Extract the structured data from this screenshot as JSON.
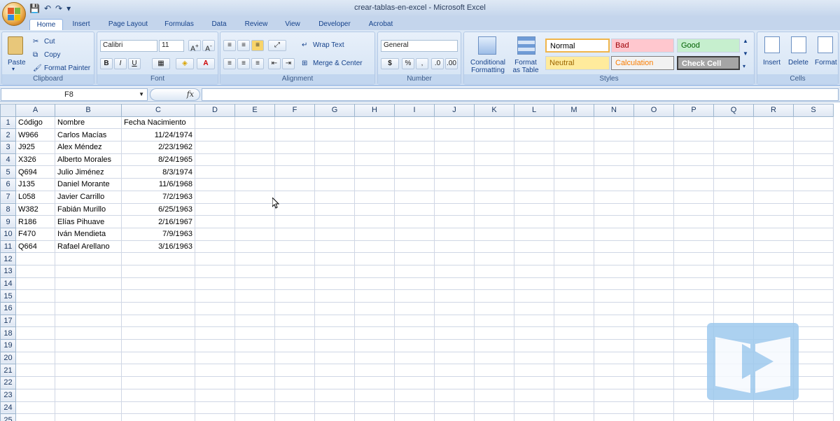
{
  "window": {
    "title": "crear-tablas-en-excel - Microsoft Excel"
  },
  "tabs": [
    "Home",
    "Insert",
    "Page Layout",
    "Formulas",
    "Data",
    "Review",
    "View",
    "Developer",
    "Acrobat"
  ],
  "active_tab": "Home",
  "clipboard": {
    "paste": "Paste",
    "cut": "Cut",
    "copy": "Copy",
    "format_painter": "Format Painter",
    "label": "Clipboard"
  },
  "font": {
    "name": "Calibri",
    "size": "11",
    "label": "Font",
    "bold": "B",
    "italic": "I",
    "underline": "U"
  },
  "alignment": {
    "wrap": "Wrap Text",
    "merge": "Merge & Center",
    "label": "Alignment"
  },
  "number": {
    "format": "General",
    "currency": "$",
    "percent": "%",
    "comma": ",",
    "label": "Number"
  },
  "styles": {
    "label": "Styles",
    "conditional": "Conditional Formatting",
    "format_table": "Format as Table",
    "normal": "Normal",
    "bad": "Bad",
    "good": "Good",
    "neutral": "Neutral",
    "calculation": "Calculation",
    "check": "Check Cell"
  },
  "cells": {
    "label": "Cells",
    "insert": "Insert",
    "delete": "Delete",
    "format": "Format"
  },
  "formula_bar": {
    "name_box": "F8",
    "fx": "fx",
    "value": ""
  },
  "columns": [
    "A",
    "B",
    "C",
    "D",
    "E",
    "F",
    "G",
    "H",
    "I",
    "J",
    "K",
    "L",
    "M",
    "N",
    "O",
    "P",
    "Q",
    "R",
    "S"
  ],
  "rows": [
    [
      "Código",
      "Nombre",
      "Fecha Nacimiento"
    ],
    [
      "W966",
      "Carlos Macías",
      "11/24/1974"
    ],
    [
      "J925",
      "Alex Méndez",
      "2/23/1962"
    ],
    [
      "X326",
      "Alberto Morales",
      "8/24/1965"
    ],
    [
      "Q694",
      "Julio Jiménez",
      "8/3/1974"
    ],
    [
      "J135",
      "Daniel Morante",
      "11/6/1968"
    ],
    [
      "L058",
      "Javier Carrillo",
      "7/2/1963"
    ],
    [
      "W382",
      "Fabián Murillo",
      "6/25/1963"
    ],
    [
      "R186",
      "Elías Pihuave",
      "2/16/1967"
    ],
    [
      "F470",
      "Iván Mendieta",
      "7/9/1963"
    ],
    [
      "Q664",
      "Rafael Arellano",
      "3/16/1963"
    ]
  ],
  "row_count": 25
}
